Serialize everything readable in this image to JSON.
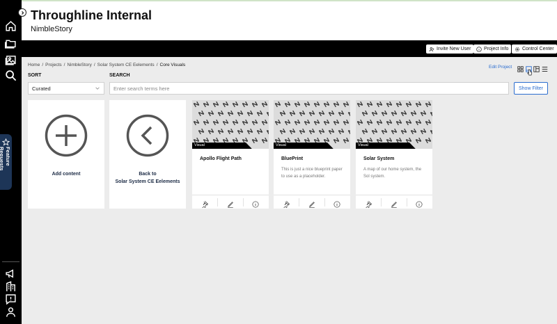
{
  "header": {
    "title": "Throughline Internal",
    "subtitle": "NimbleStory"
  },
  "toolbar": {
    "invite_label": "Invite New User",
    "project_info_label": "Project Info",
    "control_center_label": "Control Center"
  },
  "breadcrumb": {
    "items": [
      "Home",
      "Projects",
      "NimbleStory",
      "Solar System CE Eelements"
    ],
    "current": "Core Visuals",
    "separator": "/"
  },
  "actions": {
    "edit_project_label": "Edit Project"
  },
  "sort": {
    "label": "SORT",
    "selected": "Curated"
  },
  "search": {
    "label": "SEARCH",
    "placeholder": "Enter search terms here",
    "filter_label": "Show Filter"
  },
  "feature_tab": {
    "label": "Feature Requests"
  },
  "cards": {
    "add": {
      "caption": "Add content"
    },
    "back": {
      "line1": "Back to",
      "line2": "Solar System CE Eelements"
    },
    "items": [
      {
        "tag": "Visual",
        "title": "Apollo Flight Path",
        "description": ""
      },
      {
        "tag": "Visual",
        "title": "BluePrint",
        "description": "This is just a nice blueprint paper to use as a placeholder."
      },
      {
        "tag": "Visual",
        "title": "Solar System",
        "description": "A map of our home system, the Sol system."
      }
    ]
  },
  "icons": {
    "rail_top": [
      "home-icon",
      "folder-icon",
      "image-icon",
      "search-icon"
    ],
    "rail_bottom": [
      "megaphone-icon",
      "building-icon",
      "feedback-icon",
      "user-icon"
    ],
    "card_actions": [
      "pin-icon",
      "pencil-icon",
      "info-icon"
    ]
  },
  "colors": {
    "accent": "#2a6ccf",
    "feature_tab": "#1d3557",
    "rail": "#000000"
  }
}
